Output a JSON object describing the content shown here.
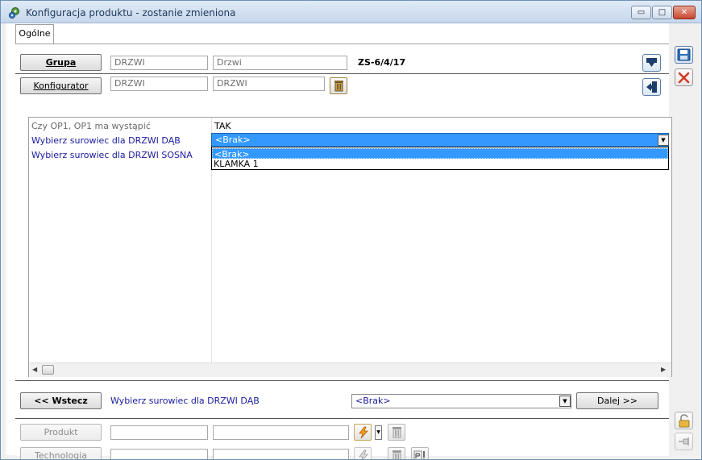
{
  "window": {
    "title": "Konfiguracja produktu - zostanie zmieniona",
    "minimize_glyph": "▭",
    "maximize_glyph": "□",
    "close_glyph": "✕"
  },
  "tabs": [
    {
      "label": "Ogólne",
      "active": true
    }
  ],
  "header": {
    "grupa_button": "Grupa",
    "grupa_code": "DRZWI",
    "grupa_name": "Drzwi",
    "document_number": "ZS-6/4/17",
    "konfigurator_button": "Konfigurator",
    "konfigurator_code": "DRZWI",
    "konfigurator_name": "DRZWI"
  },
  "grid": {
    "rows": [
      {
        "question": "Czy OP1, OP1 ma wystąpić",
        "answer": "TAK"
      },
      {
        "question": "Wybierz surowiec dla DRZWI DĄB",
        "answer": "<Brak>"
      },
      {
        "question": "Wybierz surowiec dla DRZWI SOSNA",
        "answer": ""
      }
    ],
    "dropdown": {
      "selected": "<Brak>",
      "options": [
        "<Brak>",
        "KLAMKA 1"
      ]
    }
  },
  "navigation": {
    "back_button": "<< Wstecz",
    "current_question": "Wybierz surowiec dla DRZWI DĄB",
    "current_value": "<Brak>",
    "next_button": "Dalej >>"
  },
  "bottom": {
    "produkt_button": "Produkt",
    "produkt_code": "",
    "produkt_name": "",
    "technologia_button": "Technologia",
    "technologia_code": "",
    "technologia_name": ""
  },
  "colors": {
    "selection": "#3399ff",
    "question_link": "#1a1a9e",
    "save_icon": "#2f6fb5",
    "cancel_icon": "#d43a25",
    "lightning": "#f0a020"
  },
  "icons": [
    "gear-app-icon",
    "save-icon",
    "cancel-icon",
    "import-icon",
    "exit-icon",
    "trash-icon",
    "lightning-icon",
    "text-icon",
    "lock-icon",
    "pin-icon"
  ]
}
